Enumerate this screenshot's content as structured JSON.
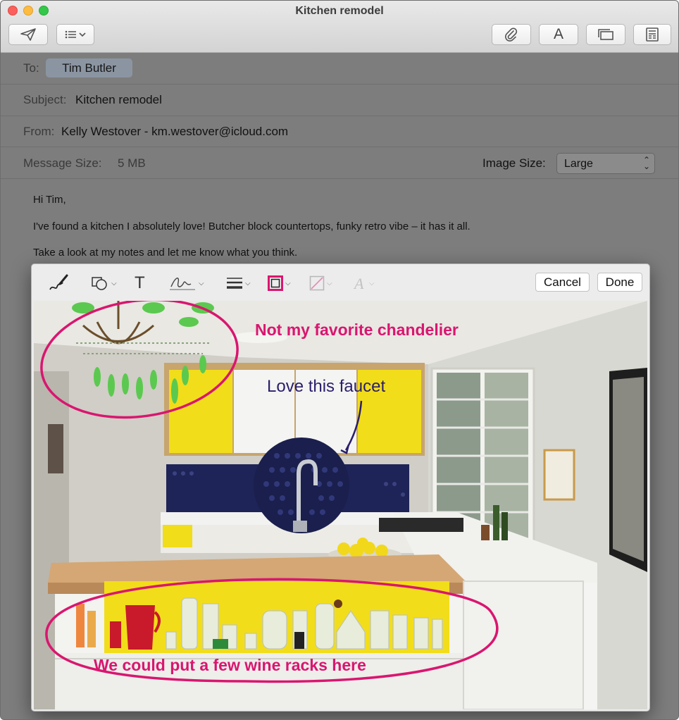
{
  "window": {
    "title": "Kitchen remodel"
  },
  "toolbar": {
    "send_icon": "paper-plane-icon",
    "format_icon": "list-icon",
    "attach_icon": "paperclip-icon",
    "fonts_label": "A",
    "browser_icon": "photo-browser-icon",
    "template_icon": "template-icon"
  },
  "header": {
    "to_label": "To:",
    "to_recipient": "Tim Butler",
    "subject_label": "Subject:",
    "subject_value": "Kitchen remodel",
    "from_label": "From:",
    "from_value": "Kelly Westover - km.westover@icloud.com",
    "size_label": "Message Size:",
    "size_value": "5 MB",
    "image_size_label": "Image Size:",
    "image_size_value": "Large"
  },
  "body": {
    "greeting": "Hi Tim,",
    "line1": "I've found a kitchen I absolutely love! Butcher block countertops, funky retro vibe – it has it all.",
    "line2": "Take a look at my notes and let me know what you think."
  },
  "markup": {
    "tools": [
      "sketch-icon",
      "shapes-icon",
      "text-icon",
      "signature-icon",
      "line-style-icon",
      "border-color-icon",
      "fill-color-icon",
      "text-style-icon"
    ],
    "text_tool_label": "T",
    "cancel_label": "Cancel",
    "done_label": "Done",
    "annotations": {
      "chandelier": "Not my favorite chandelier",
      "faucet": "Love this faucet",
      "wine": "We could put a few wine racks here"
    }
  },
  "colors": {
    "annotation_pink": "#d9166f",
    "annotation_navy": "#2a1e6b",
    "cabinet_yellow": "#f2dd1a",
    "backsplash_navy": "#1f2458"
  }
}
